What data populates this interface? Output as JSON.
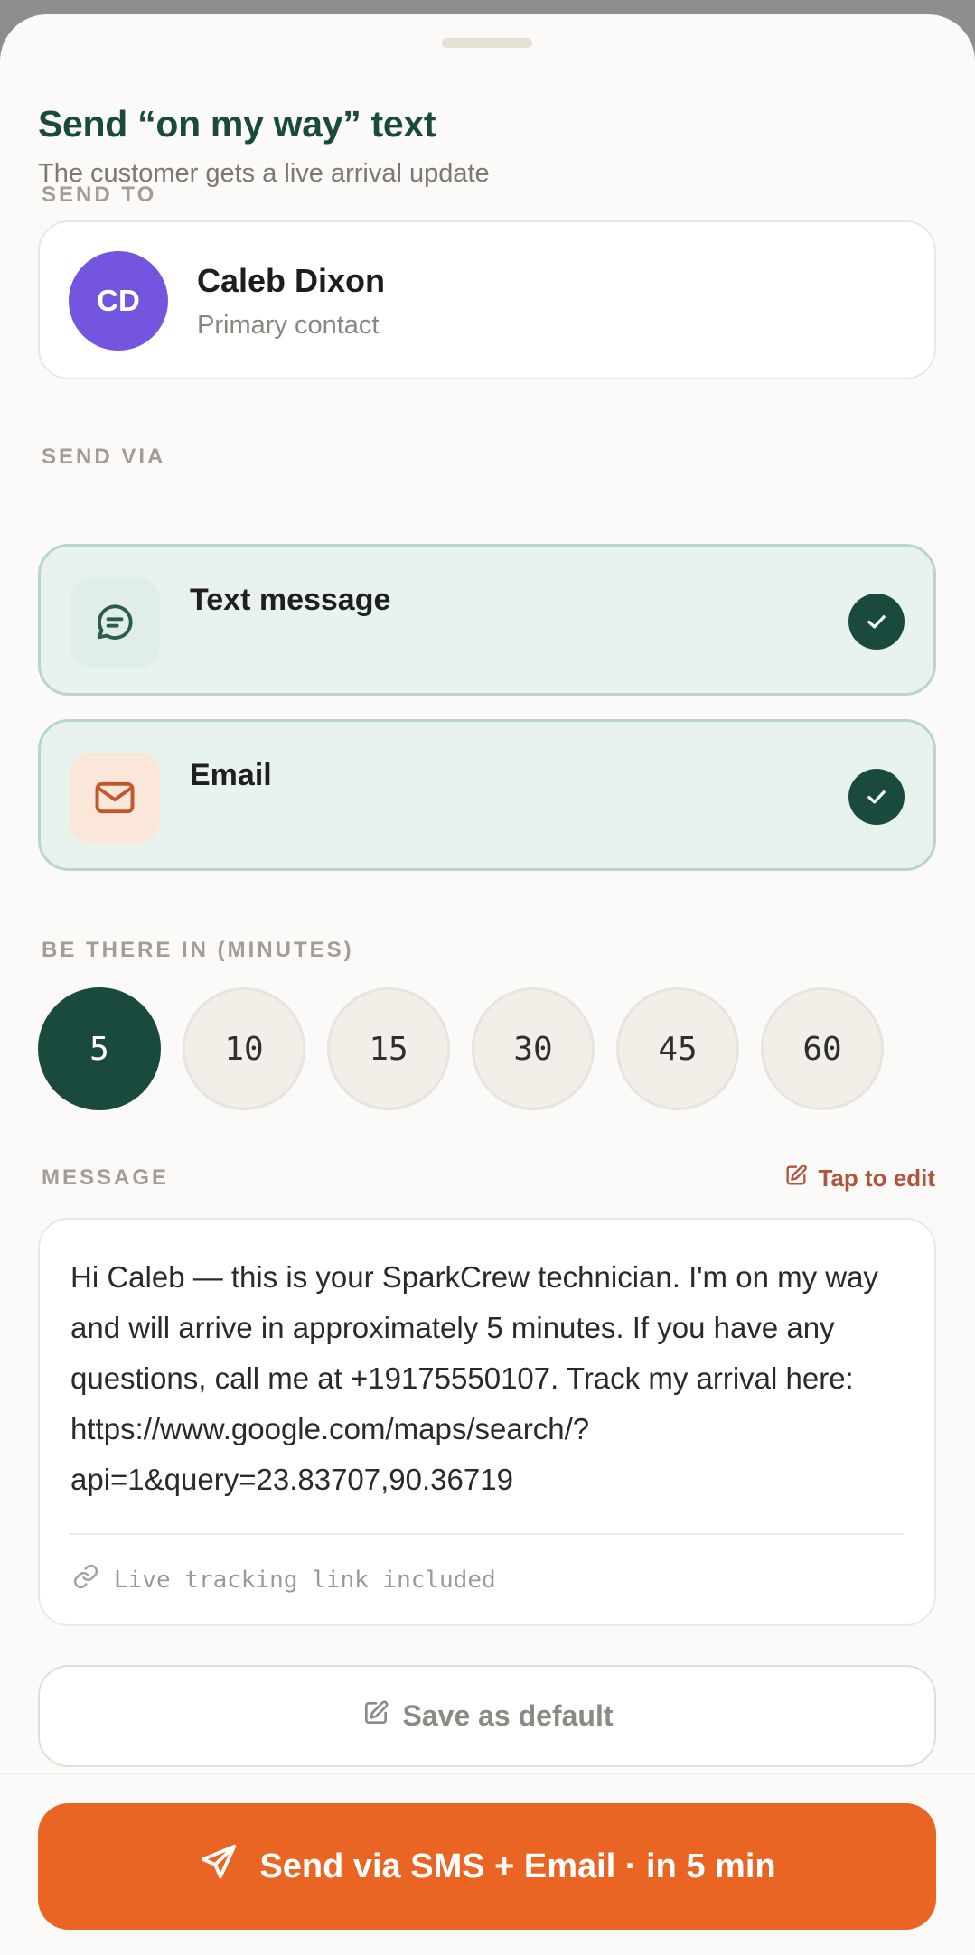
{
  "sheet": {
    "title": "Send “on my way” text",
    "subtitle": "The customer gets a live arrival update"
  },
  "send_to": {
    "label": "SEND TO",
    "contact": {
      "initials": "CD",
      "name": "Caleb Dixon",
      "role": "Primary contact",
      "avatar_color": "#7355df"
    }
  },
  "send_via": {
    "label": "SEND VIA",
    "channels": [
      {
        "label": "Text message",
        "icon": "chat-bubble-icon",
        "selected": true
      },
      {
        "label": "Email",
        "icon": "mail-icon",
        "selected": true
      }
    ]
  },
  "eta": {
    "label": "BE THERE IN (MINUTES)",
    "options": [
      "5",
      "10",
      "15",
      "30",
      "45",
      "60"
    ],
    "selected": "5"
  },
  "message": {
    "label": "MESSAGE",
    "edit_label": "Tap to edit",
    "text": "Hi Caleb — this is your SparkCrew technician. I'm on my way and will arrive in approximately 5 minutes. If you have any questions, call me at +19175550107. Track my arrival here: https://www.google.com/maps/search/?api=1&query=23.83707,90.36719",
    "footer_note": "Live tracking link included"
  },
  "actions": {
    "save_default_label": "Save as default",
    "send_label": "Send via SMS + Email · in 5 min"
  },
  "colors": {
    "primary_green": "#1a4a3d",
    "accent_orange": "#ea6523",
    "selected_bg": "#e8f3ee",
    "edit_link": "#b0553a"
  }
}
